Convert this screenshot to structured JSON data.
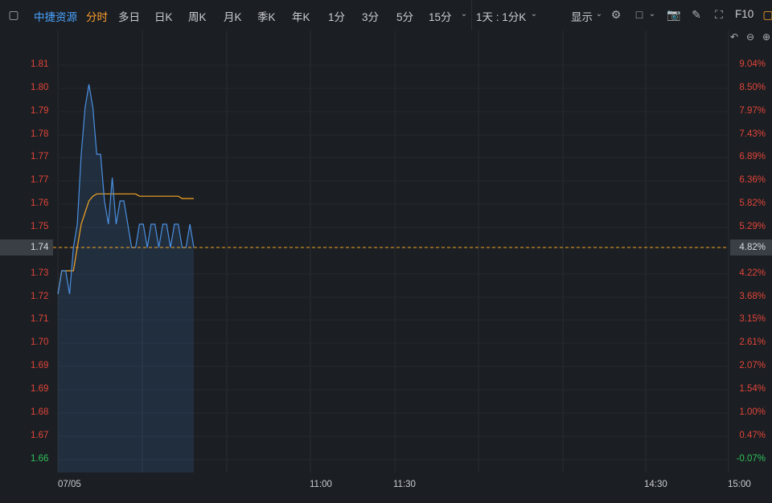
{
  "toolbar": {
    "stock_name": "中捷资源",
    "tabs": [
      "分时",
      "多日",
      "日K",
      "周K",
      "月K",
      "季K",
      "年K",
      "1分",
      "3分",
      "5分",
      "15分"
    ],
    "period_select": "1天 : 1分K",
    "display_label": "显示",
    "f10_label": "F10"
  },
  "axes": {
    "left_labels": [
      "1.81",
      "1.80",
      "1.79",
      "1.78",
      "1.77",
      "1.77",
      "1.76",
      "1.75",
      "1.74",
      "1.73",
      "1.72",
      "1.71",
      "1.70",
      "1.69",
      "1.69",
      "1.68",
      "1.67",
      "1.66"
    ],
    "right_labels": [
      "9.04%",
      "8.50%",
      "7.97%",
      "7.43%",
      "6.89%",
      "6.36%",
      "5.82%",
      "5.29%",
      "4.82%",
      "4.22%",
      "3.68%",
      "3.15%",
      "2.61%",
      "2.07%",
      "1.54%",
      "1.00%",
      "0.47%",
      "-0.07%"
    ],
    "x_labels": [
      "07/05",
      "11:00",
      "11:30",
      "14:30",
      "15:00"
    ]
  },
  "current": {
    "price": "1.74",
    "percent": "4.82%"
  },
  "colors": {
    "price_line": "#4a90e2",
    "avg_line": "#f5a623",
    "up": "#e2453a",
    "down": "#2fc25b",
    "active_tab": "#ff9f2f",
    "stock_name": "#4aa3ff"
  },
  "chart_data": {
    "type": "line",
    "title": "",
    "xlabel": "",
    "ylabel": "",
    "ylim": [
      1.66,
      1.81
    ],
    "series": [
      {
        "values": [
          1.72,
          1.73,
          1.73,
          1.72,
          1.74,
          1.75,
          1.78,
          1.8,
          1.81,
          1.8,
          1.78,
          1.78,
          1.76,
          1.75,
          1.77,
          1.75,
          1.76,
          1.76,
          1.75,
          1.74,
          1.74,
          1.75,
          1.75,
          1.74,
          1.75,
          1.75,
          1.74,
          1.75,
          1.75,
          1.74,
          1.75,
          1.75,
          1.74,
          1.74,
          1.75,
          1.74
        ]
      },
      {
        "values": [
          1.72,
          1.73,
          1.73,
          1.73,
          1.73,
          1.74,
          1.75,
          1.755,
          1.76,
          1.762,
          1.763,
          1.763,
          1.763,
          1.763,
          1.763,
          1.763,
          1.763,
          1.763,
          1.763,
          1.763,
          1.763,
          1.762,
          1.762,
          1.762,
          1.762,
          1.762,
          1.762,
          1.762,
          1.762,
          1.762,
          1.762,
          1.762,
          1.761,
          1.761,
          1.761,
          1.761
        ]
      }
    ]
  }
}
